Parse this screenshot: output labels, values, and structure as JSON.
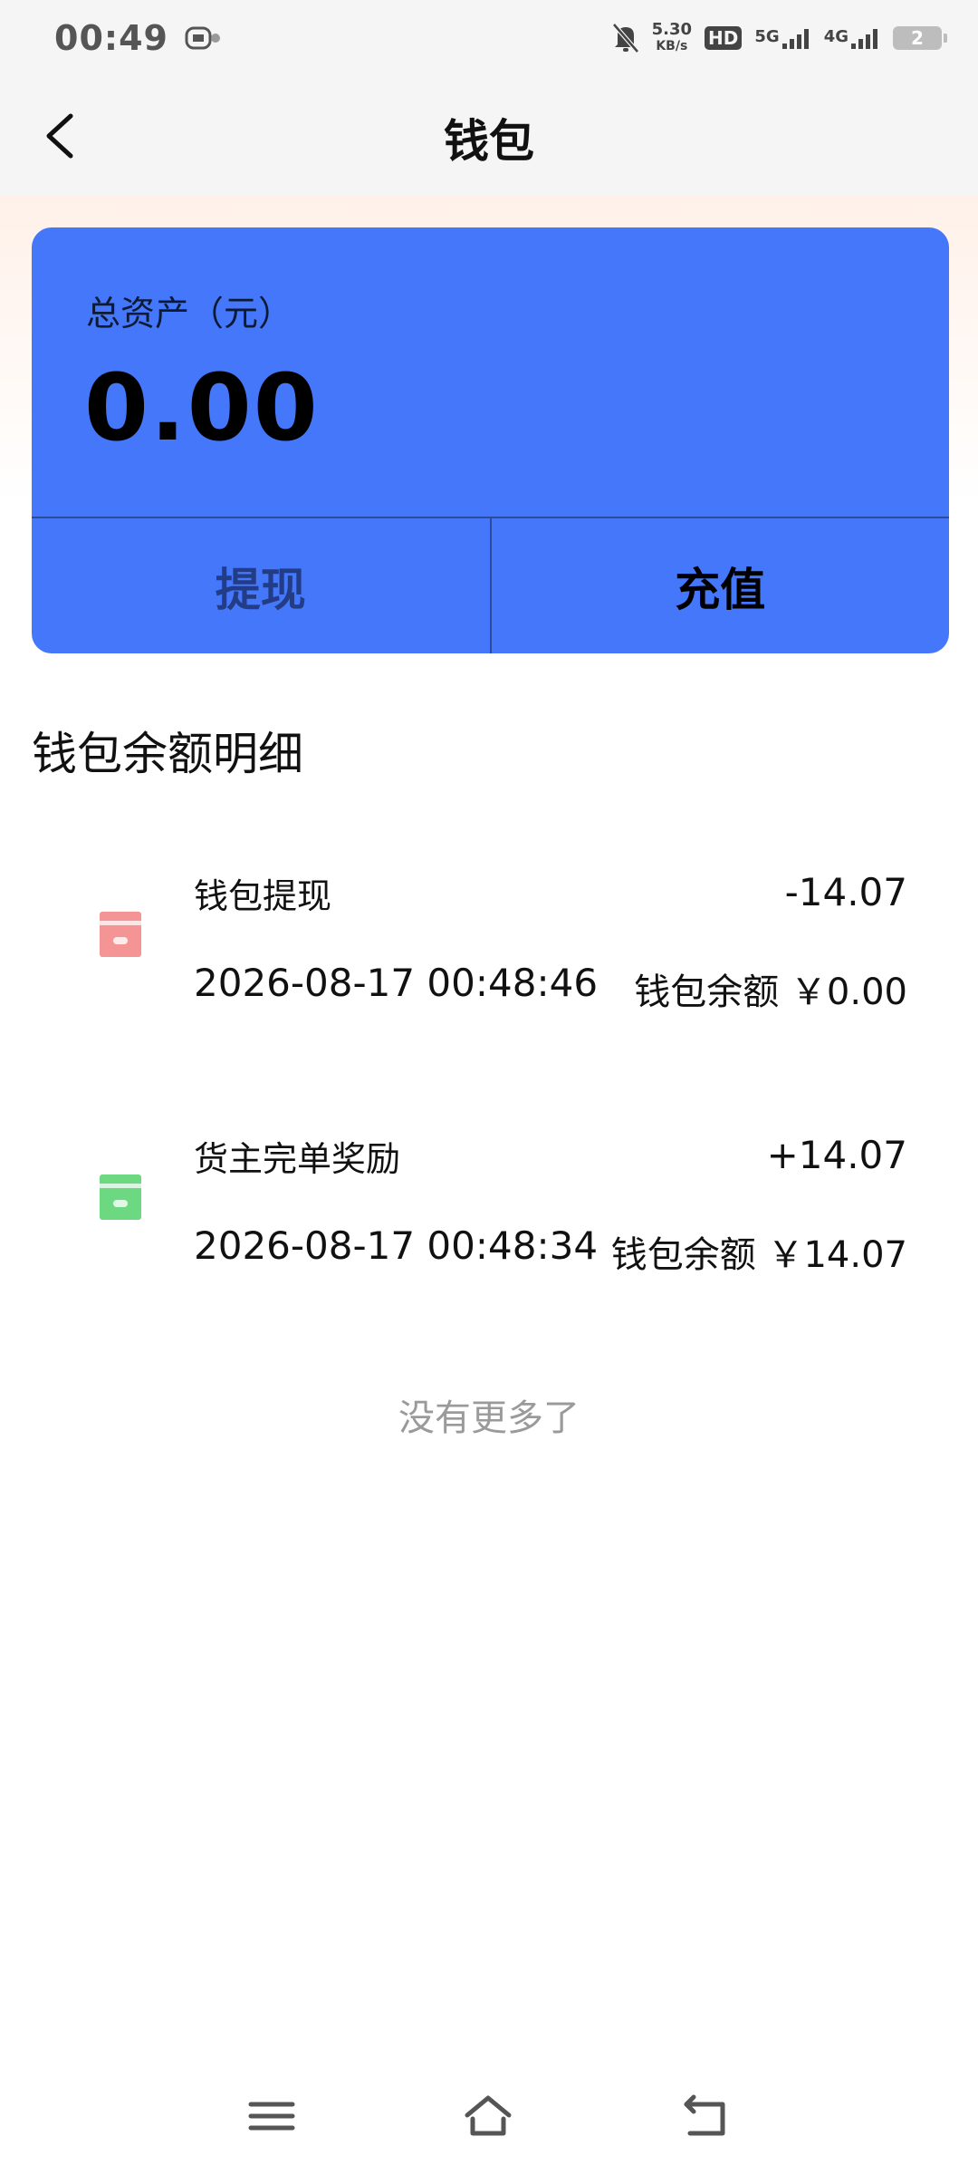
{
  "status_bar": {
    "time": "00:49",
    "net_speed_value": "5.30",
    "net_speed_unit": "KB/s",
    "hd_label": "HD",
    "sim1_label": "5G",
    "sim2_label": "4G",
    "battery": "2",
    "icons": [
      "robot-icon",
      "mute-bell-icon",
      "hd-icon",
      "signal-5g-icon",
      "signal-4g-icon",
      "battery-icon"
    ]
  },
  "nav": {
    "title": "钱包",
    "back_icon": "chevron-left-icon"
  },
  "wallet": {
    "asset_label": "总资产（元）",
    "asset_value": "0.00",
    "withdraw_label": "提现",
    "recharge_label": "充值",
    "card_color": "#4577fb"
  },
  "details": {
    "title": "钱包余额明细",
    "records": [
      {
        "title": "钱包提现",
        "amount": "-14.07",
        "time": "2026-08-17 00:48:46",
        "balance": "钱包余额 ￥0.00",
        "icon": "withdraw-card-icon",
        "icon_color": "#f59494"
      },
      {
        "title": "货主完单奖励",
        "amount": "+14.07",
        "time": "2026-08-17 00:48:34",
        "balance": "钱包余额 ￥14.07",
        "icon": "reward-card-icon",
        "icon_color": "#6cd982"
      }
    ],
    "no_more": "没有更多了"
  },
  "system_nav": {
    "icons": [
      "menu-icon",
      "home-icon",
      "back-icon"
    ]
  }
}
